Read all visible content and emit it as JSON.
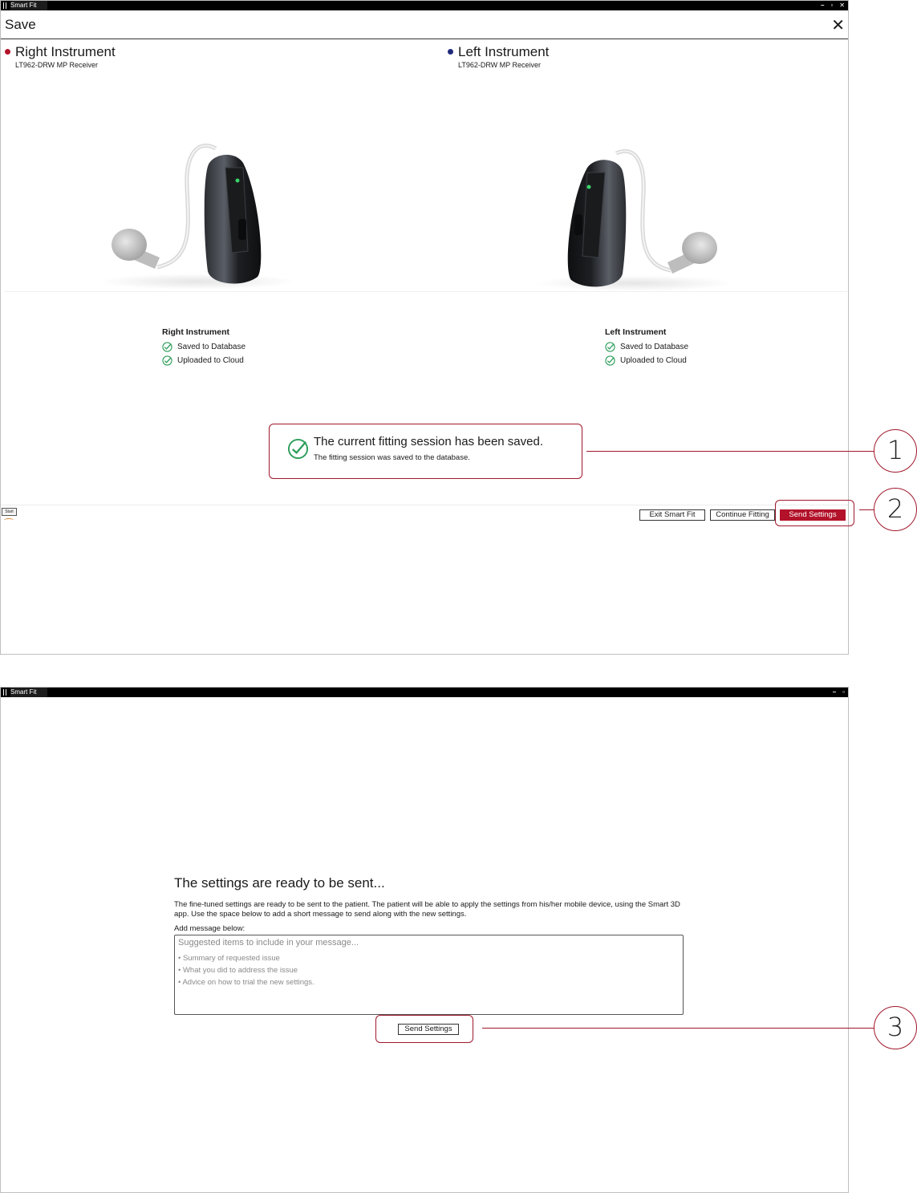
{
  "app": {
    "title": "Smart Fit"
  },
  "screen1": {
    "header_title": "Save",
    "right": {
      "name": "Right Instrument",
      "model": "LT962-DRW  MP Receiver",
      "dot_color": "#b3122a",
      "status_title": "Right Instrument",
      "status": [
        "Saved to Database",
        "Uploaded to Cloud"
      ]
    },
    "left": {
      "name": "Left Instrument",
      "model": "LT962-DRW  MP Receiver",
      "dot_color": "#1f2a7a",
      "status_title": "Left Instrument",
      "status": [
        "Saved to Database",
        "Uploaded to Cloud"
      ]
    },
    "saved_message": "The current fitting session has been saved.",
    "saved_detail": "The fitting session was saved to the database.",
    "start_label": "Start",
    "buttons": {
      "exit": "Exit Smart Fit",
      "continue": "Continue Fitting",
      "send": "Send Settings"
    }
  },
  "screen2": {
    "title": "The settings are ready to be sent...",
    "description": "The fine-tuned settings are ready to be sent to the patient. The patient will be able to apply the settings from his/her mobile device, using the Smart 3D app.  Use the space below to add a short message to send along with the new settings.",
    "message_label": "Add message below:",
    "placeholder": "Suggested items to include in your message...",
    "suggestions": [
      "Summary of requested issue",
      "What you did to address the issue",
      "Advice on how to trial the new settings."
    ],
    "send_button": "Send Settings"
  },
  "callouts": [
    "1",
    "2",
    "3"
  ],
  "colors": {
    "accent": "#b3122a",
    "check": "#2e9e5b"
  }
}
